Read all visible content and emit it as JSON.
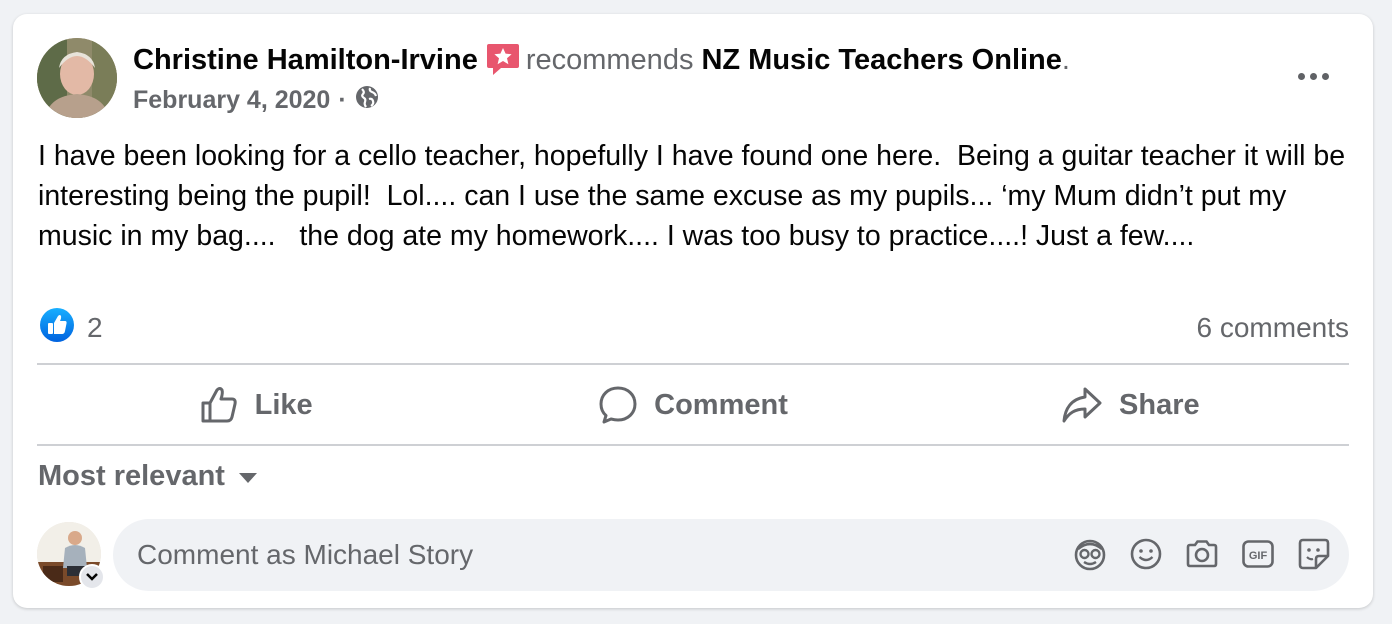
{
  "post": {
    "author": "Christine Hamilton-Irvine",
    "verb": "recommends",
    "page_name": "NZ Music Teachers Online",
    "period": ".",
    "date": "February 4, 2020",
    "date_separator": "·",
    "privacy_icon": "globe-icon",
    "text": "I have been looking for a cello teacher, hopefully I have found one here.  Being a guitar teacher it will be interesting being the pupil!  Lol.... can I use the same excuse as my pupils... ‘my Mum didn’t put my music in my bag....   the dog ate my homework.... I was too busy to practice....! Just a few...."
  },
  "stats": {
    "like_count": "2",
    "comments_label": "6 comments"
  },
  "actions": {
    "like": "Like",
    "comment": "Comment",
    "share": "Share"
  },
  "comments": {
    "sort_label": "Most relevant",
    "placeholder": "Comment as Michael Story",
    "tools": [
      "avatar-sticker-icon",
      "emoji-icon",
      "camera-icon",
      "gif-icon",
      "sticker-icon"
    ]
  },
  "colors": {
    "brand_blue": "#1877f2",
    "recommend_red": "#f02849",
    "text_primary": "#050505",
    "text_secondary": "#65676b"
  }
}
